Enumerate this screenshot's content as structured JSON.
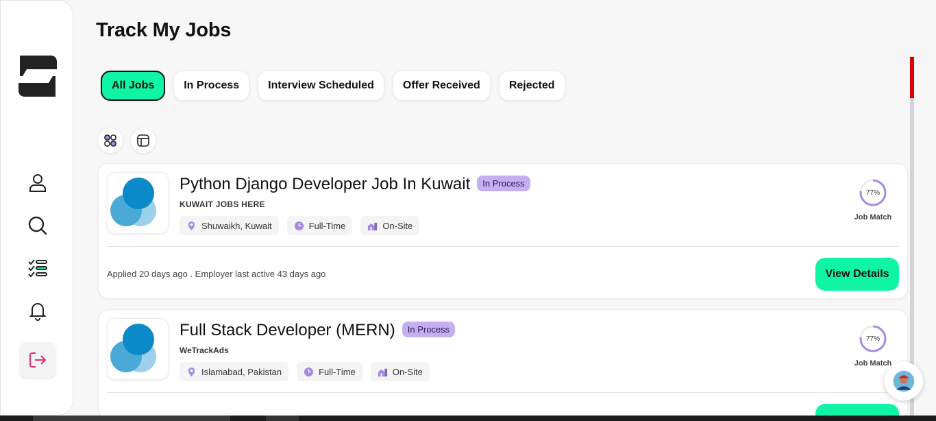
{
  "page": {
    "title": "Track My Jobs"
  },
  "tabs": [
    {
      "label": "All Jobs",
      "active": true
    },
    {
      "label": "In Process",
      "active": false
    },
    {
      "label": "Interview Scheduled",
      "active": false
    },
    {
      "label": "Offer Received",
      "active": false
    },
    {
      "label": "Rejected",
      "active": false
    }
  ],
  "sidebar": {
    "icons": [
      "profile-icon",
      "search-icon",
      "checklist-icon",
      "bell-icon",
      "logout-icon"
    ]
  },
  "jobs": [
    {
      "title": "Python Django Developer Job In Kuwait",
      "status": "In Process",
      "company": "KUWAIT JOBS HERE",
      "location": "Shuwaikh, Kuwait",
      "type": "Full-Time",
      "workplace": "On-Site",
      "match_percent": "77%",
      "match_label": "Job Match",
      "applied_text": "Applied 20 days ago . Employer last active 43 days ago",
      "action_label": "View Details"
    },
    {
      "title": "Full Stack Developer (MERN)",
      "status": "In Process",
      "company": "WeTrackAds",
      "location": "Islamabad, Pakistan",
      "type": "Full-Time",
      "workplace": "On-Site",
      "match_percent": "77%",
      "match_label": "Job Match"
    }
  ],
  "colors": {
    "accent": "#10f5a5",
    "badge_bg": "#c4b0f0",
    "match_ring": "#a48be0",
    "scroll_thumb": "#e00000"
  }
}
